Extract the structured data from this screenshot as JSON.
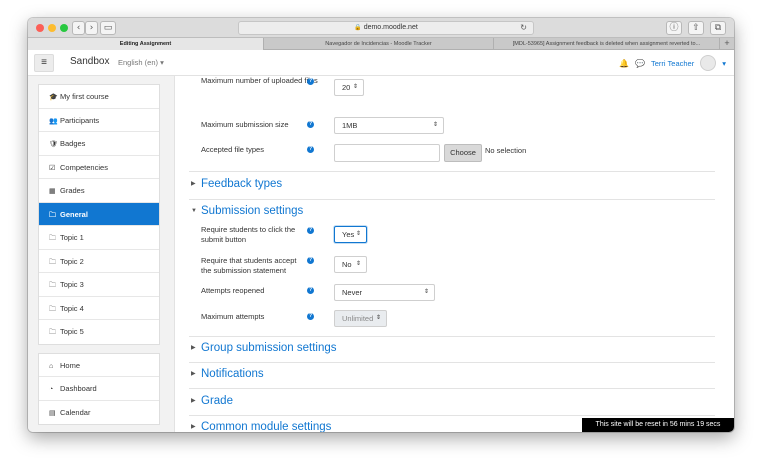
{
  "browser": {
    "url": "demo.moodle.net",
    "tabs": [
      {
        "label": "Editing Assignment",
        "active": true
      },
      {
        "label": "Navegador de Incidencias - Moodle Tracker",
        "active": false
      },
      {
        "label": "[MDL-53965] Assignment feedback is deleted when assignment reverted to...",
        "active": false
      }
    ],
    "new_tab": "+"
  },
  "navbar": {
    "brand": "Sandbox",
    "language": "English (en) ▾",
    "user_name": "Terri Teacher",
    "menu_caret": "▾"
  },
  "sidebar": {
    "course_items": [
      {
        "label": "My first course",
        "icon": "graduation-cap-icon",
        "glyph": "🎓"
      },
      {
        "label": "Participants",
        "icon": "users-icon",
        "glyph": "👥"
      },
      {
        "label": "Badges",
        "icon": "shield-icon",
        "glyph": "🛡"
      },
      {
        "label": "Competencies",
        "icon": "check-square-icon",
        "glyph": "☑"
      },
      {
        "label": "Grades",
        "icon": "table-icon",
        "glyph": "▦"
      },
      {
        "label": "General",
        "icon": "folder-icon",
        "glyph": "🗀",
        "active": true
      },
      {
        "label": "Topic 1",
        "icon": "folder-icon",
        "glyph": "🗀"
      },
      {
        "label": "Topic 2",
        "icon": "folder-icon",
        "glyph": "🗀"
      },
      {
        "label": "Topic 3",
        "icon": "folder-icon",
        "glyph": "🗀"
      },
      {
        "label": "Topic 4",
        "icon": "folder-icon",
        "glyph": "🗀"
      },
      {
        "label": "Topic 5",
        "icon": "folder-icon",
        "glyph": "🗀"
      }
    ],
    "site_items": [
      {
        "label": "Home",
        "icon": "home-icon",
        "glyph": "⌂"
      },
      {
        "label": "Dashboard",
        "icon": "dashboard-icon",
        "glyph": "◔"
      },
      {
        "label": "Calendar",
        "icon": "calendar-icon",
        "glyph": "▤"
      }
    ]
  },
  "form": {
    "max_files": {
      "label": "Maximum number of uploaded files",
      "value": "20"
    },
    "max_size": {
      "label": "Maximum submission size",
      "value": "1MB"
    },
    "file_types": {
      "label": "Accepted file types",
      "button": "Choose",
      "status": "No selection"
    },
    "sections": {
      "feedback": "Feedback types",
      "submission": "Submission settings",
      "group": "Group submission settings",
      "notifications": "Notifications",
      "grade": "Grade",
      "common": "Common module settings"
    },
    "require_click": {
      "label_line1": "Require students to click the",
      "label_line2": "submit button",
      "value": "Yes"
    },
    "require_accept": {
      "label_line1": "Require that students accept",
      "label_line2": "the submission statement",
      "value": "No"
    },
    "attempts_reopened": {
      "label": "Attempts reopened",
      "value": "Never"
    },
    "max_attempts": {
      "label": "Maximum attempts",
      "value": "Unlimited"
    }
  },
  "banner": "This site will be reset in 56 mins 19 secs",
  "colors": {
    "accent": "#1177d1"
  }
}
